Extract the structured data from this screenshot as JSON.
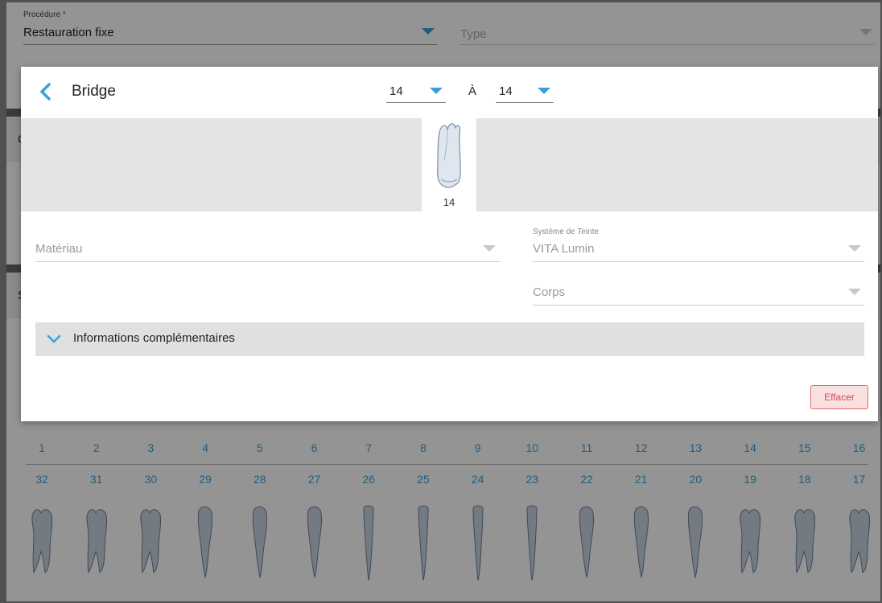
{
  "background": {
    "procedure_label": "Procédure",
    "procedure_required_mark": "*",
    "procedure_value": "Restauration fixe",
    "type_placeholder": "Type",
    "upper_numbers": [
      "1",
      "2",
      "3",
      "4",
      "5",
      "6",
      "7",
      "8",
      "9",
      "10",
      "11",
      "12",
      "13",
      "14",
      "15",
      "16"
    ],
    "lower_numbers": [
      "32",
      "31",
      "30",
      "29",
      "28",
      "27",
      "26",
      "25",
      "24",
      "23",
      "22",
      "21",
      "20",
      "19",
      "18",
      "17"
    ],
    "section_letters": [
      "C",
      "S"
    ]
  },
  "modal": {
    "title": "Bridge",
    "from_tooth": "14",
    "to_label": "À",
    "to_tooth": "14",
    "selected_tooth_number": "14",
    "material_placeholder": "Matériau",
    "shade_system_label": "Système de Teinte",
    "shade_system_value": "VITA Lumin",
    "body_placeholder": "Corps",
    "additional_info_label": "Informations complémentaires",
    "clear_button": "Effacer"
  },
  "colors": {
    "accent": "#3aa0dc",
    "clear_button_text": "#d14a55",
    "clear_button_bg": "#fbe0e2"
  },
  "icons": {
    "back": "chevron-left-icon",
    "dropdown": "triangle-down-icon",
    "expand": "chevron-down-icon"
  }
}
